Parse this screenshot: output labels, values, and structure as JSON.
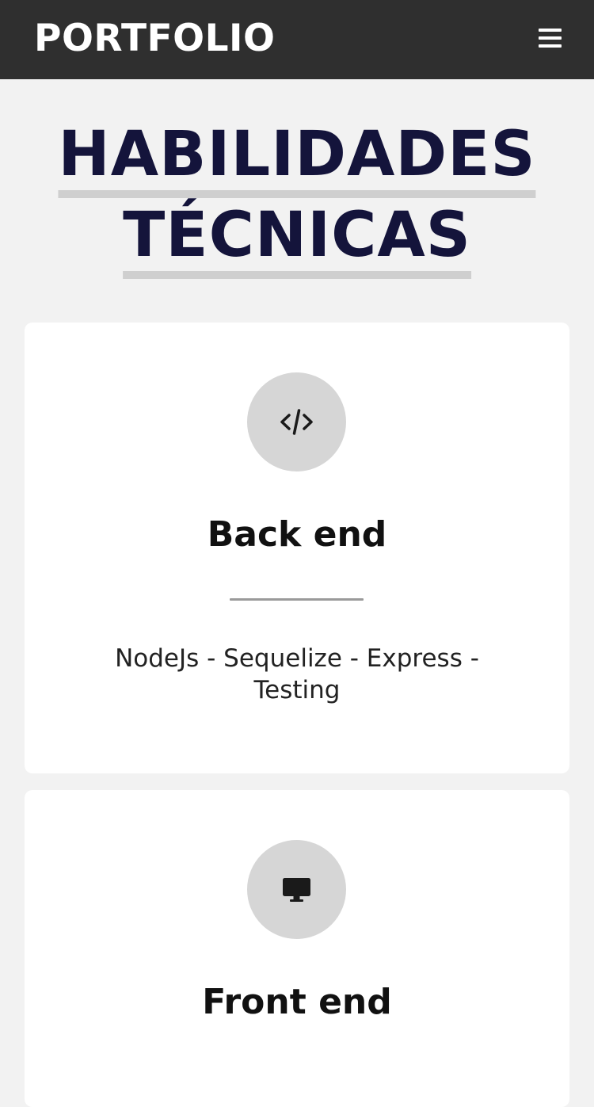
{
  "navbar": {
    "brand": "PORTFOLIO",
    "menu_icon": "hamburger-menu-icon"
  },
  "section": {
    "title_line1": "HABILIDADES",
    "title_line2": "TÉCNICAS"
  },
  "cards": [
    {
      "icon": "code-icon",
      "title": "Back end",
      "description": "NodeJs - Sequelize - Express - Testing"
    },
    {
      "icon": "desktop-monitor-icon",
      "title": "Front end"
    }
  ],
  "colors": {
    "navbar_bg": "#2f2f2f",
    "page_bg": "#f2f2f2",
    "title_text": "#14143b",
    "title_underline": "#cfcfcf",
    "icon_circle": "#d6d6d6"
  }
}
